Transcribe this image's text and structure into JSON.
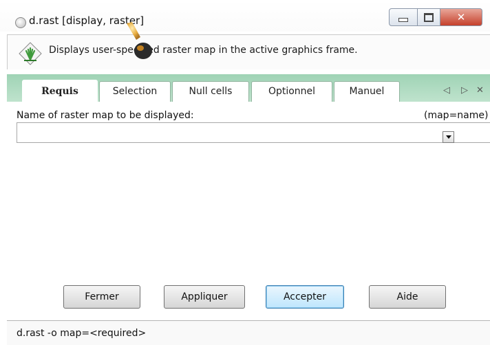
{
  "window": {
    "title": "d.rast [display, raster]"
  },
  "description": {
    "text": "Displays user-specified raster map in the active graphics frame."
  },
  "tabs": [
    {
      "label": "Requis",
      "active": true
    },
    {
      "label": "Selection",
      "active": false
    },
    {
      "label": "Null cells",
      "active": false
    },
    {
      "label": "Optionnel",
      "active": false
    },
    {
      "label": "Manuel",
      "active": false
    }
  ],
  "tab_nav": {
    "left": "◁",
    "right": "▷",
    "close": "✕"
  },
  "field": {
    "label": "Name of raster map to be displayed:",
    "hint": "(map=name)",
    "value": ""
  },
  "buttons": {
    "close": "Fermer",
    "apply": "Appliquer",
    "accept": "Accepter",
    "help": "Aide"
  },
  "status": {
    "command": "d.rast -o map=<required>"
  },
  "colors": {
    "tabstrip": "#b0dcc3",
    "close_button": "#c5402b",
    "default_button_border": "#3c7fb1"
  }
}
